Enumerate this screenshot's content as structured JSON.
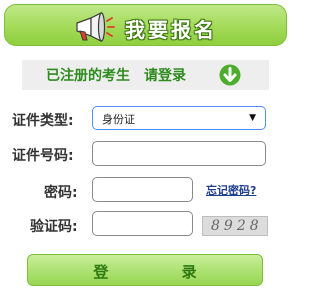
{
  "header": {
    "title": "我要报名",
    "icon": "megaphone-icon",
    "colors": {
      "banner": "#a6dc5c",
      "title_outline": "#3f7a12"
    }
  },
  "subbar": {
    "text_part1": "已注册的考生",
    "text_part2": "请登录",
    "icon": "arrow-down-circle-icon",
    "color": "#2e8b1e"
  },
  "form": {
    "id_type_label": "证件类型:",
    "id_type_selected": "身份证",
    "id_number_label": "证件号码:",
    "id_number_value": "",
    "password_label": "密码:",
    "password_value": "",
    "forgot_link": "忘记密码?",
    "captcha_label": "验证码:",
    "captcha_value": "",
    "captcha_image_text": "8928"
  },
  "login_button": {
    "label": "登 录"
  }
}
